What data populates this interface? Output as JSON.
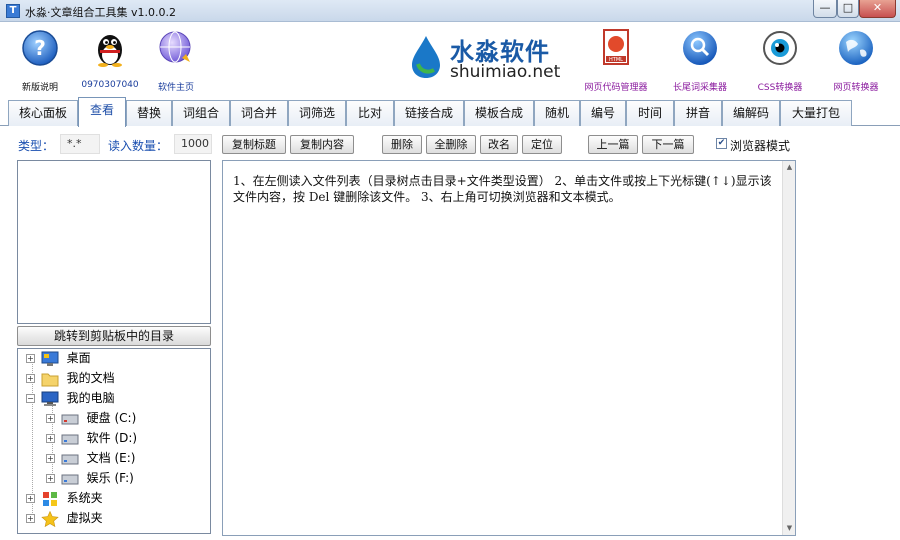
{
  "window": {
    "title": "水淼·文章组合工具集 v1.0.0.2",
    "controls": {
      "minimize": "—",
      "maximize": "□",
      "close": "✕"
    }
  },
  "toolbar": {
    "items": [
      {
        "label": "新版说明",
        "icon": "help-icon"
      },
      {
        "label": "0970307040",
        "icon": "qq-penguin-icon"
      },
      {
        "label": "软件主页",
        "icon": "globe-home-icon"
      }
    ],
    "right_items": [
      {
        "label": "网页代码管理器",
        "icon": "html-file-icon"
      },
      {
        "label": "长尾词采集器",
        "icon": "search-globe-icon"
      },
      {
        "label": "CSS转换器",
        "icon": "eye-icon"
      },
      {
        "label": "网页转换器",
        "icon": "globe-icon"
      }
    ],
    "logo": {
      "cn": "水淼软件",
      "en": "shuimiao.net"
    }
  },
  "tabs": [
    "核心面板",
    "查看",
    "替换",
    "词组合",
    "词合并",
    "词筛选",
    "比对",
    "链接合成",
    "模板合成",
    "随机",
    "编号",
    "时间",
    "拼音",
    "编解码",
    "大量打包"
  ],
  "active_tab": "查看",
  "options": {
    "type_label": "类型：",
    "type_value": "*.*",
    "count_label": "读入数量：",
    "count_value": "1000",
    "copy_title": "复制标题",
    "copy_content": "复制内容",
    "delete": "删除",
    "delete_all": "全删除",
    "rename": "改名",
    "locate": "定位",
    "prev": "上一篇",
    "next": "下一篇",
    "browser_mode": "浏览器模式",
    "browser_mode_checked": true
  },
  "left": {
    "jump_button": "跳转到剪贴板中的目录",
    "tree": [
      {
        "label": "桌面",
        "icon": "desktop-icon"
      },
      {
        "label": "我的文档",
        "icon": "folder-icon"
      },
      {
        "label": "我的电脑",
        "icon": "computer-icon"
      },
      {
        "label": "硬盘 (C:)",
        "icon": "drive-c-icon"
      },
      {
        "label": "软件 (D:)",
        "icon": "drive-d-icon"
      },
      {
        "label": "文档 (E:)",
        "icon": "drive-e-icon"
      },
      {
        "label": "娱乐 (F:)",
        "icon": "drive-f-icon"
      },
      {
        "label": "系统夹",
        "icon": "windows-logo-icon"
      },
      {
        "label": "虚拟夹",
        "icon": "star-icon"
      }
    ]
  },
  "content": {
    "text": "1、在左侧读入文件列表（目录树点击目录+文件类型设置） 2、单击文件或按上下光标键(↑↓)显示该文件内容，按 Del 键删除该文件。 3、右上角可切换浏览器和文本模式。"
  }
}
